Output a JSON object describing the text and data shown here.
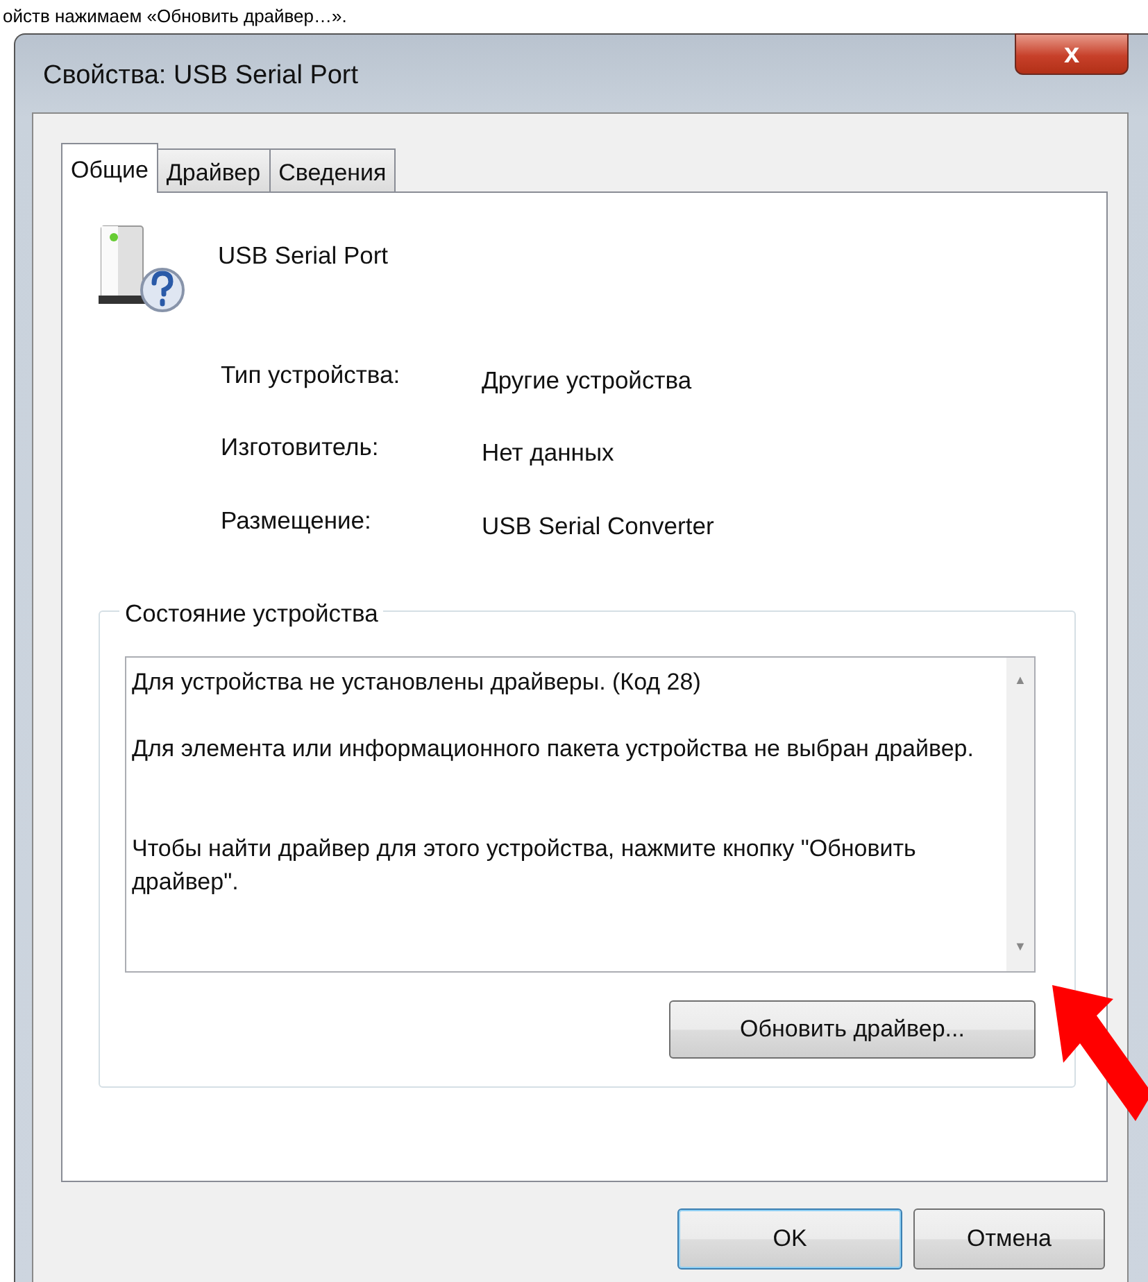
{
  "caption_fragment": "ойств нажимаем «Обновить драйвер…».",
  "window": {
    "title": "Свойства: USB Serial Port",
    "close": "x"
  },
  "tabs": [
    {
      "label": "Общие",
      "selected": true
    },
    {
      "label": "Драйвер",
      "selected": false
    },
    {
      "label": "Сведения",
      "selected": false
    }
  ],
  "device": {
    "name": "USB Serial Port"
  },
  "properties": [
    {
      "label": "Тип устройства:",
      "value": "Другие устройства"
    },
    {
      "label": "Изготовитель:",
      "value": "Нет данных"
    },
    {
      "label": "Размещение:",
      "value": "USB Serial Converter"
    }
  ],
  "status_group": {
    "title": "Состояние устройства",
    "text": "Для устройства не установлены драйверы. (Код 28)\n\nДля элемента или информационного пакета устройства не выбран драйвер.\n\n\nЧтобы найти драйвер для этого устройства, нажмите кнопку \"Обновить драйвер\".",
    "button": "Обновить драйвер...",
    "scroll_up": "▲",
    "scroll_down": "▼"
  },
  "buttons": [
    {
      "label": "OK",
      "default": true
    },
    {
      "label": "Отмена",
      "default": false
    }
  ]
}
